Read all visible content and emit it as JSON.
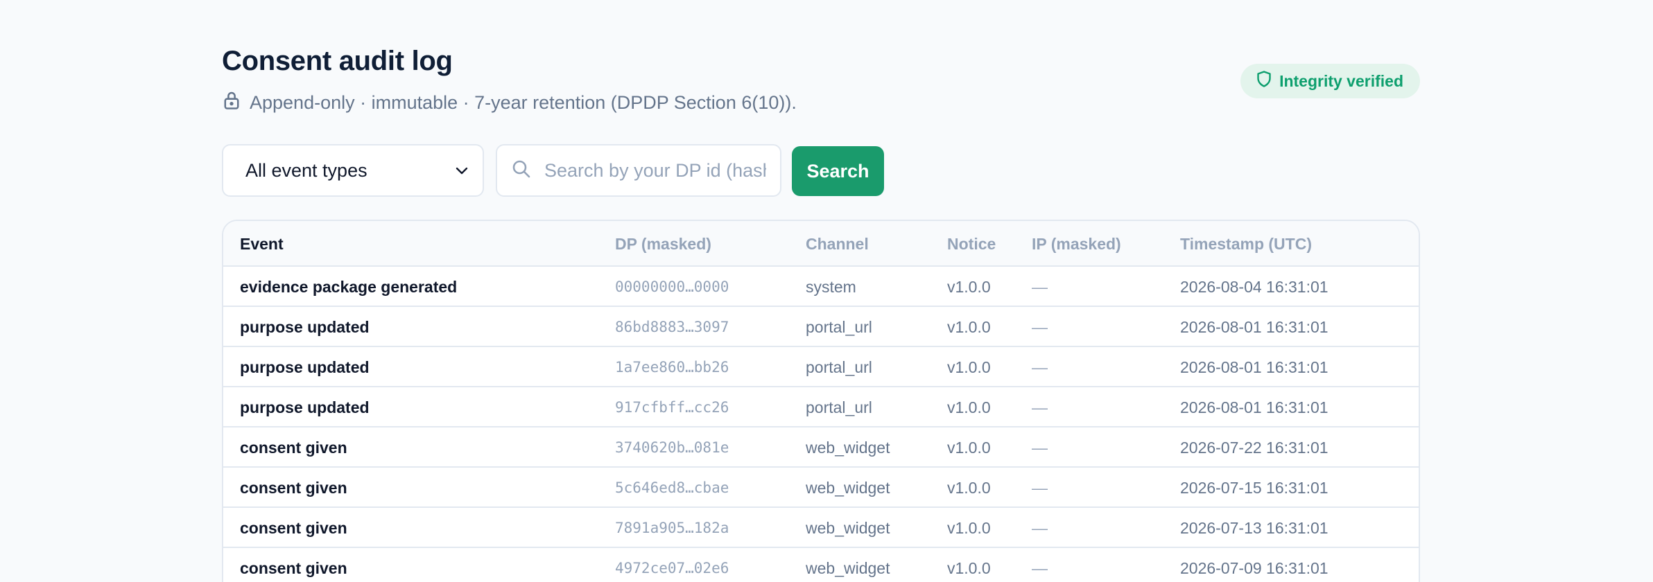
{
  "header": {
    "title": "Consent audit log",
    "subtitle": "Append-only · immutable · 7-year retention (DPDP Section 6(10)).",
    "badge": "Integrity verified"
  },
  "filters": {
    "event_type_selected": "All event types",
    "search_placeholder": "Search by your DP id (hashed)",
    "search_button": "Search"
  },
  "table": {
    "columns": [
      "Event",
      "DP (masked)",
      "Channel",
      "Notice",
      "IP (masked)",
      "Timestamp (UTC)"
    ],
    "rows": [
      {
        "event": "evidence package generated",
        "dp": "00000000…0000",
        "channel": "system",
        "notice": "v1.0.0",
        "ip": "—",
        "ts": "2026-08-04 16:31:01"
      },
      {
        "event": "purpose updated",
        "dp": "86bd8883…3097",
        "channel": "portal_url",
        "notice": "v1.0.0",
        "ip": "—",
        "ts": "2026-08-01 16:31:01"
      },
      {
        "event": "purpose updated",
        "dp": "1a7ee860…bb26",
        "channel": "portal_url",
        "notice": "v1.0.0",
        "ip": "—",
        "ts": "2026-08-01 16:31:01"
      },
      {
        "event": "purpose updated",
        "dp": "917cfbff…cc26",
        "channel": "portal_url",
        "notice": "v1.0.0",
        "ip": "—",
        "ts": "2026-08-01 16:31:01"
      },
      {
        "event": "consent given",
        "dp": "3740620b…081e",
        "channel": "web_widget",
        "notice": "v1.0.0",
        "ip": "—",
        "ts": "2026-07-22 16:31:01"
      },
      {
        "event": "consent given",
        "dp": "5c646ed8…cbae",
        "channel": "web_widget",
        "notice": "v1.0.0",
        "ip": "—",
        "ts": "2026-07-15 16:31:01"
      },
      {
        "event": "consent given",
        "dp": "7891a905…182a",
        "channel": "web_widget",
        "notice": "v1.0.0",
        "ip": "—",
        "ts": "2026-07-13 16:31:01"
      },
      {
        "event": "consent given",
        "dp": "4972ce07…02e6",
        "channel": "web_widget",
        "notice": "v1.0.0",
        "ip": "—",
        "ts": "2026-07-09 16:31:01"
      }
    ]
  },
  "colors": {
    "accent": "#1a9b6c",
    "badge_bg": "#e3f4ec",
    "badge_text": "#0e9f6e"
  },
  "icons": {
    "subtitle": "lock-icon",
    "badge": "shield-icon",
    "select": "chevron-down-icon",
    "search": "search-icon"
  }
}
